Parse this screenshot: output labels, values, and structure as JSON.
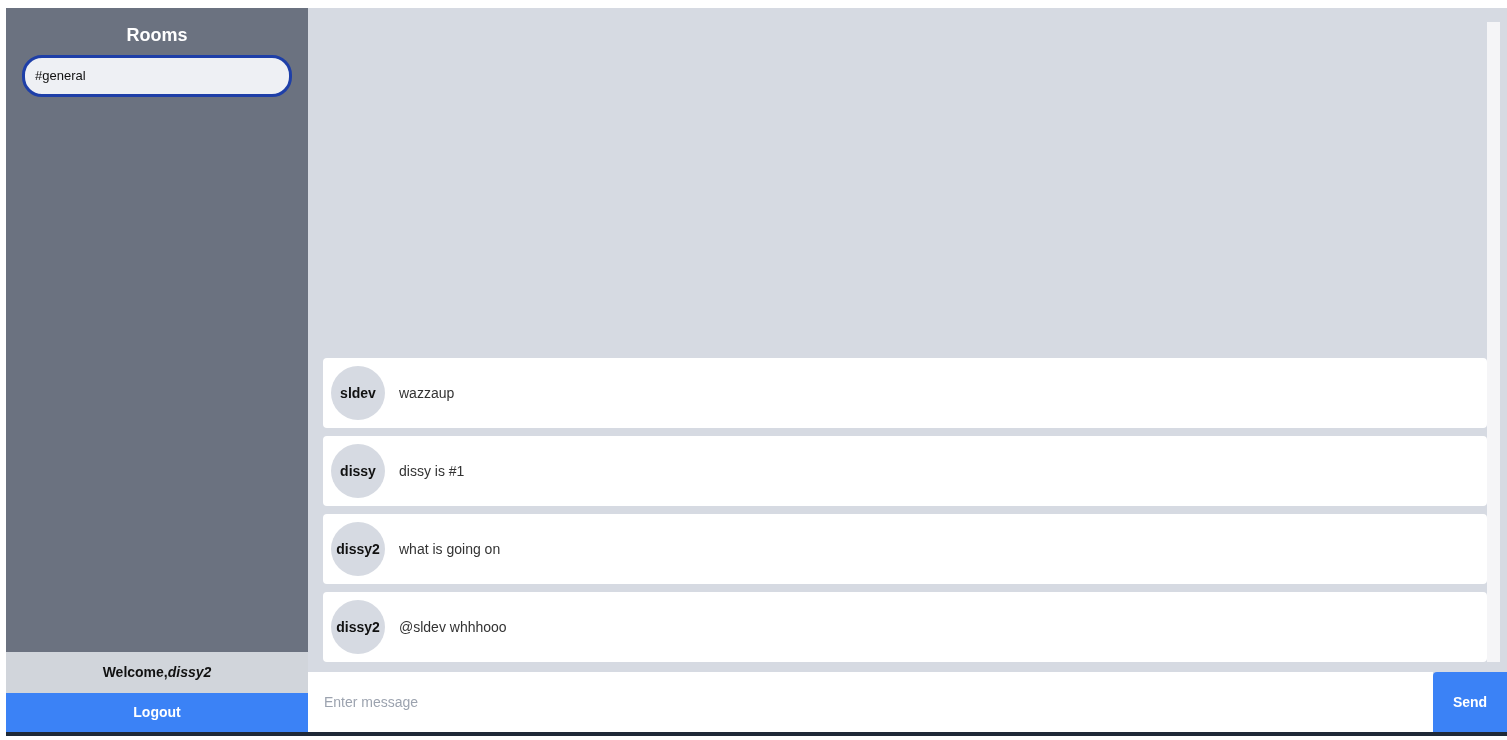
{
  "sidebar": {
    "title": "Rooms",
    "rooms": [
      {
        "label": "#general",
        "selected": true
      }
    ],
    "welcome": "Welcome,*dissy2*",
    "logout": "Logout"
  },
  "messages": [
    {
      "user": "sldev",
      "text": "wazzaup"
    },
    {
      "user": "dissy",
      "text": "dissy is #1"
    },
    {
      "user": "dissy2",
      "text": "what is going on"
    },
    {
      "user": "dissy2",
      "text": "@sldev whhhooo"
    }
  ],
  "composer": {
    "placeholder": "Enter message",
    "send": "Send"
  }
}
